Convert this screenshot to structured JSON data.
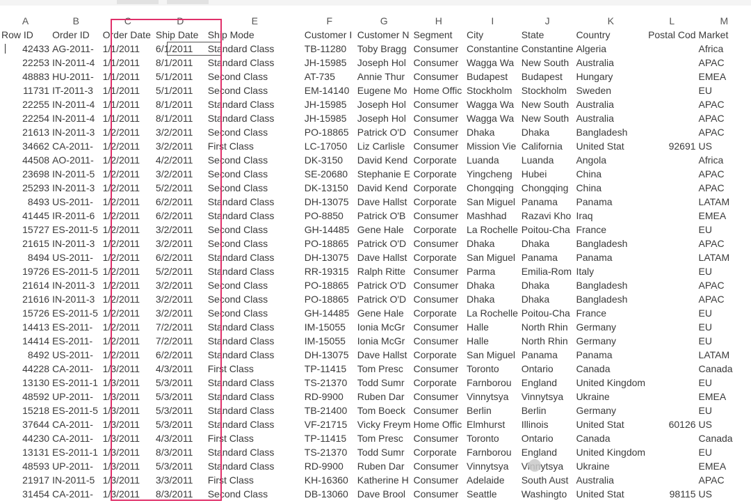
{
  "columns": [
    "A",
    "B",
    "C",
    "D",
    "E",
    "F",
    "G",
    "H",
    "I",
    "J",
    "K",
    "L",
    "M"
  ],
  "headers": [
    "Row ID",
    "Order ID",
    "Order Date",
    "Ship Date",
    "Ship Mode",
    "Customer I",
    "Customer N",
    "Segment",
    "City",
    "State",
    "Country",
    "Postal Cod",
    "Market"
  ],
  "rows": [
    [
      "42433",
      "AG-2011-",
      "1/1/2011",
      "6/1/2011",
      "Standard Class",
      "TB-11280",
      "Toby Bragg",
      "Consumer",
      "Constantine",
      "Constantine",
      "Algeria",
      "",
      "Africa"
    ],
    [
      "22253",
      "IN-2011-4",
      "1/1/2011",
      "8/1/2011",
      "Standard Class",
      "JH-15985",
      "Joseph Hol",
      "Consumer",
      "Wagga Wa",
      "New South",
      "Australia",
      "",
      "APAC"
    ],
    [
      "48883",
      "HU-2011-",
      "1/1/2011",
      "5/1/2011",
      "Second Class",
      "AT-735",
      "Annie Thur",
      "Consumer",
      "Budapest",
      "Budapest",
      "Hungary",
      "",
      "EMEA"
    ],
    [
      "11731",
      "IT-2011-3",
      "1/1/2011",
      "5/1/2011",
      "Second Class",
      "EM-14140",
      "Eugene Mo",
      "Home Offic",
      "Stockholm",
      "Stockholm",
      "Sweden",
      "",
      "EU"
    ],
    [
      "22255",
      "IN-2011-4",
      "1/1/2011",
      "8/1/2011",
      "Standard Class",
      "JH-15985",
      "Joseph Hol",
      "Consumer",
      "Wagga Wa",
      "New South",
      "Australia",
      "",
      "APAC"
    ],
    [
      "22254",
      "IN-2011-4",
      "1/1/2011",
      "8/1/2011",
      "Standard Class",
      "JH-15985",
      "Joseph Hol",
      "Consumer",
      "Wagga Wa",
      "New South",
      "Australia",
      "",
      "APAC"
    ],
    [
      "21613",
      "IN-2011-3",
      "1/2/2011",
      "3/2/2011",
      "Second Class",
      "PO-18865",
      "Patrick O'D",
      "Consumer",
      "Dhaka",
      "Dhaka",
      "Bangladesh",
      "",
      "APAC"
    ],
    [
      "34662",
      "CA-2011-",
      "1/2/2011",
      "3/2/2011",
      "First Class",
      "LC-17050",
      "Liz Carlisle",
      "Consumer",
      "Mission Vie",
      "California",
      "United Stat",
      "92691",
      "US"
    ],
    [
      "44508",
      "AO-2011-",
      "1/2/2011",
      "4/2/2011",
      "Second Class",
      "DK-3150",
      "David Kend",
      "Corporate",
      "Luanda",
      "Luanda",
      "Angola",
      "",
      "Africa"
    ],
    [
      "23698",
      "IN-2011-5",
      "1/2/2011",
      "3/2/2011",
      "Second Class",
      "SE-20680",
      "Stephanie E",
      "Corporate",
      "Yingcheng",
      "Hubei",
      "China",
      "",
      "APAC"
    ],
    [
      "25293",
      "IN-2011-3",
      "1/2/2011",
      "5/2/2011",
      "Second Class",
      "DK-13150",
      "David Kend",
      "Corporate",
      "Chongqing",
      "Chongqing",
      "China",
      "",
      "APAC"
    ],
    [
      "8493",
      "US-2011-",
      "1/2/2011",
      "6/2/2011",
      "Standard Class",
      "DH-13075",
      "Dave Hallst",
      "Corporate",
      "San Miguel",
      "Panama",
      "Panama",
      "",
      "LATAM"
    ],
    [
      "41445",
      "IR-2011-6",
      "1/2/2011",
      "6/2/2011",
      "Standard Class",
      "PO-8850",
      "Patrick O'B",
      "Consumer",
      "Mashhad",
      "Razavi Kho",
      "Iraq",
      "",
      "EMEA"
    ],
    [
      "15727",
      "ES-2011-5",
      "1/2/2011",
      "3/2/2011",
      "Second Class",
      "GH-14485",
      "Gene Hale",
      "Corporate",
      "La Rochelle",
      "Poitou-Cha",
      "France",
      "",
      "EU"
    ],
    [
      "21615",
      "IN-2011-3",
      "1/2/2011",
      "3/2/2011",
      "Second Class",
      "PO-18865",
      "Patrick O'D",
      "Consumer",
      "Dhaka",
      "Dhaka",
      "Bangladesh",
      "",
      "APAC"
    ],
    [
      "8494",
      "US-2011-",
      "1/2/2011",
      "6/2/2011",
      "Standard Class",
      "DH-13075",
      "Dave Hallst",
      "Corporate",
      "San Miguel",
      "Panama",
      "Panama",
      "",
      "LATAM"
    ],
    [
      "19726",
      "ES-2011-5",
      "1/2/2011",
      "5/2/2011",
      "Standard Class",
      "RR-19315",
      "Ralph Ritte",
      "Consumer",
      "Parma",
      "Emilia-Rom",
      "Italy",
      "",
      "EU"
    ],
    [
      "21614",
      "IN-2011-3",
      "1/2/2011",
      "3/2/2011",
      "Second Class",
      "PO-18865",
      "Patrick O'D",
      "Consumer",
      "Dhaka",
      "Dhaka",
      "Bangladesh",
      "",
      "APAC"
    ],
    [
      "21616",
      "IN-2011-3",
      "1/2/2011",
      "3/2/2011",
      "Second Class",
      "PO-18865",
      "Patrick O'D",
      "Consumer",
      "Dhaka",
      "Dhaka",
      "Bangladesh",
      "",
      "APAC"
    ],
    [
      "15726",
      "ES-2011-5",
      "1/2/2011",
      "3/2/2011",
      "Second Class",
      "GH-14485",
      "Gene Hale",
      "Corporate",
      "La Rochelle",
      "Poitou-Cha",
      "France",
      "",
      "EU"
    ],
    [
      "14413",
      "ES-2011-",
      "1/2/2011",
      "7/2/2011",
      "Standard Class",
      "IM-15055",
      "Ionia McGr",
      "Consumer",
      "Halle",
      "North Rhin",
      "Germany",
      "",
      "EU"
    ],
    [
      "14414",
      "ES-2011-",
      "1/2/2011",
      "7/2/2011",
      "Standard Class",
      "IM-15055",
      "Ionia McGr",
      "Consumer",
      "Halle",
      "North Rhin",
      "Germany",
      "",
      "EU"
    ],
    [
      "8492",
      "US-2011-",
      "1/2/2011",
      "6/2/2011",
      "Standard Class",
      "DH-13075",
      "Dave Hallst",
      "Corporate",
      "San Miguel",
      "Panama",
      "Panama",
      "",
      "LATAM"
    ],
    [
      "44228",
      "CA-2011-",
      "1/3/2011",
      "4/3/2011",
      "First Class",
      "TP-11415",
      "Tom Presc",
      "Consumer",
      "Toronto",
      "Ontario",
      "Canada",
      "",
      "Canada"
    ],
    [
      "13130",
      "ES-2011-1",
      "1/3/2011",
      "5/3/2011",
      "Standard Class",
      "TS-21370",
      "Todd Sumr",
      "Corporate",
      "Farnborou",
      "England",
      "United Kingdom",
      "",
      "EU"
    ],
    [
      "48592",
      "UP-2011-",
      "1/3/2011",
      "5/3/2011",
      "Standard Class",
      "RD-9900",
      "Ruben Dar",
      "Consumer",
      "Vinnytsya",
      "Vinnytsya",
      "Ukraine",
      "",
      "EMEA"
    ],
    [
      "15218",
      "ES-2011-5",
      "1/3/2011",
      "5/3/2011",
      "Standard Class",
      "TB-21400",
      "Tom Boeck",
      "Consumer",
      "Berlin",
      "Berlin",
      "Germany",
      "",
      "EU"
    ],
    [
      "37644",
      "CA-2011-",
      "1/3/2011",
      "5/3/2011",
      "Standard Class",
      "VF-21715",
      "Vicky Freym",
      "Home Offic",
      "Elmhurst",
      "Illinois",
      "United Stat",
      "60126",
      "US"
    ],
    [
      "44230",
      "CA-2011-",
      "1/3/2011",
      "4/3/2011",
      "First Class",
      "TP-11415",
      "Tom Presc",
      "Consumer",
      "Toronto",
      "Ontario",
      "Canada",
      "",
      "Canada"
    ],
    [
      "13131",
      "ES-2011-1",
      "1/3/2011",
      "8/3/2011",
      "Standard Class",
      "TS-21370",
      "Todd Sumr",
      "Corporate",
      "Farnborou",
      "England",
      "United Kingdom",
      "",
      "EU"
    ],
    [
      "48593",
      "UP-2011-",
      "1/3/2011",
      "5/3/2011",
      "Standard Class",
      "RD-9900",
      "Ruben Dar",
      "Consumer",
      "Vinnytsya",
      "Vinnytsya",
      "Ukraine",
      "",
      "EMEA"
    ],
    [
      "21917",
      "IN-2011-5",
      "1/3/2011",
      "3/3/2011",
      "First Class",
      "KH-16360",
      "Katherine H",
      "Consumer",
      "Adelaide",
      "South Aust",
      "Australia",
      "",
      "APAC"
    ],
    [
      "31454",
      "CA-2011-",
      "1/3/2011",
      "8/3/2011",
      "Second Class",
      "DB-13060",
      "Dave Brool",
      "Consumer",
      "Seattle",
      "Washingto",
      "United Stat",
      "98115",
      "US"
    ]
  ]
}
